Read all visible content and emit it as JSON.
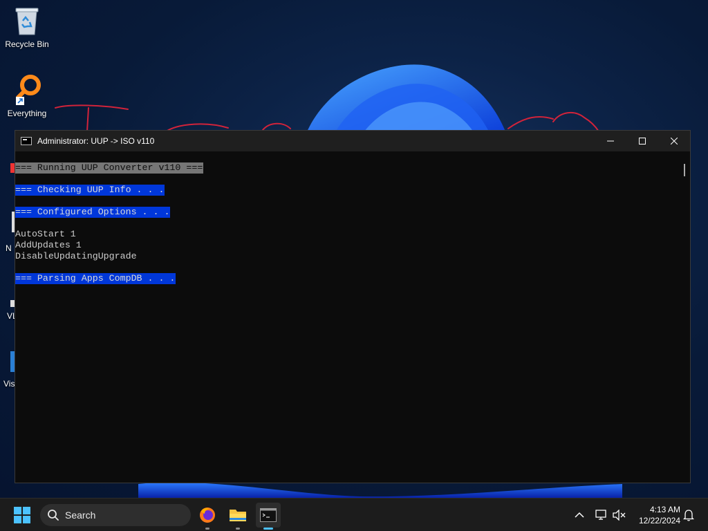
{
  "desktop": {
    "icons": [
      {
        "label": "Recycle Bin",
        "icon": "recycle-bin-icon"
      },
      {
        "label": "Everything",
        "icon": "everything-search-icon"
      }
    ],
    "partial_labels": [
      "N",
      "VL",
      "Vis"
    ]
  },
  "console": {
    "title": "Administrator:  UUP -> ISO v110",
    "lines": [
      {
        "text": "=== Running UUP Converter v110 ===",
        "style": "gray"
      },
      {
        "text": "",
        "style": "none"
      },
      {
        "text": "=== Checking UUP Info . . .",
        "style": "blue"
      },
      {
        "text": "",
        "style": "none"
      },
      {
        "text": "=== Configured Options . . .",
        "style": "blue"
      },
      {
        "text": "",
        "style": "none"
      },
      {
        "text": "AutoStart 1",
        "style": "none"
      },
      {
        "text": "AddUpdates 1",
        "style": "none"
      },
      {
        "text": "DisableUpdatingUpgrade",
        "style": "none"
      },
      {
        "text": "",
        "style": "none"
      },
      {
        "text": "=== Parsing Apps CompDB . . .",
        "style": "blue"
      }
    ],
    "colors": {
      "background": "#0c0c0c",
      "text": "#cccccc",
      "highlight_blue": "#0037da",
      "highlight_gray": "#767676"
    }
  },
  "taskbar": {
    "search_placeholder": "Search",
    "apps": [
      "firefox-icon",
      "file-explorer-icon",
      "terminal-icon"
    ],
    "tray": [
      "chevron-up-icon",
      "network-icon",
      "volume-muted-icon",
      "notification-bell-icon"
    ],
    "time": "4:13 AM",
    "date": "12/22/2024"
  }
}
